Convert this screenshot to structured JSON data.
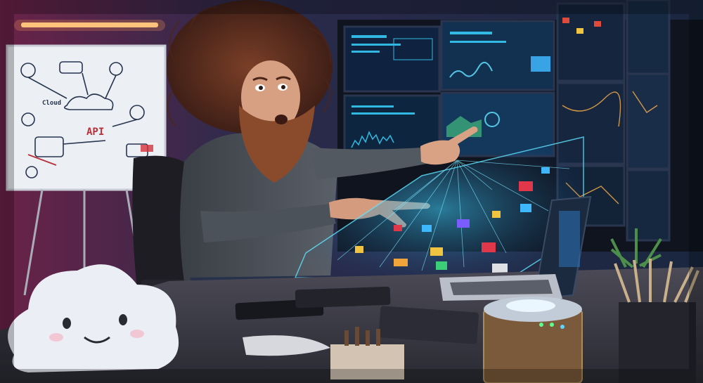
{
  "scene": {
    "whiteboard": {
      "label_api": "API",
      "label_cloud": "Cloud"
    },
    "colors": {
      "room_wall": "#2a2f4a",
      "neon_red": "#d8264a",
      "desk_light": "#f3b35a",
      "hologram_blue": "#37c8ff",
      "monitor_glow": "#5fa8ff"
    },
    "icons": [
      "cloud-plush",
      "whiteboard",
      "monitor-wall",
      "hologram-map",
      "laptop",
      "desk-lamp-device",
      "pencil-cup",
      "plant"
    ]
  }
}
